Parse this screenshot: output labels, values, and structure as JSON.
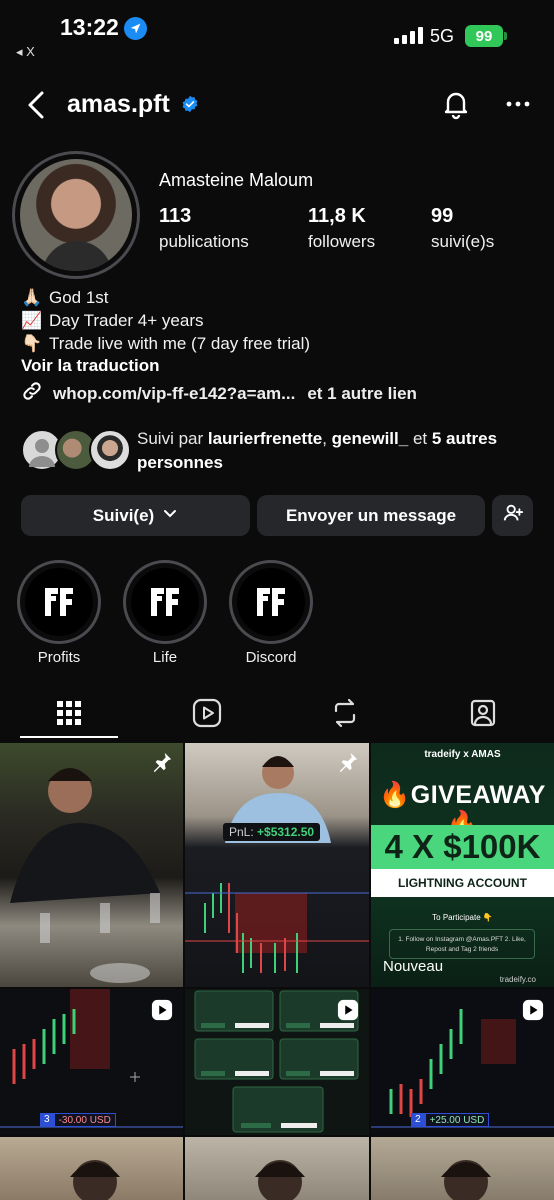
{
  "status_bar": {
    "time": "13:22",
    "back_app": "◂ X",
    "network": "5G",
    "battery": "99"
  },
  "header": {
    "username": "amas.pft"
  },
  "profile": {
    "full_name": "Amasteine Maloum",
    "stats": [
      {
        "number": "113",
        "label": "publications"
      },
      {
        "number": "11,8 K",
        "label": "followers"
      },
      {
        "number": "99",
        "label": "suivi(e)s"
      }
    ],
    "bio": [
      {
        "emoji": "🙏🏻",
        "text": "God 1st"
      },
      {
        "emoji": "📈",
        "text": "Day Trader 4+ years"
      },
      {
        "emoji": "👇🏻",
        "text": "Trade live with me (7 day free trial)"
      }
    ],
    "translate": "Voir la traduction",
    "link": "whop.com/vip-ff-e142?a=am...",
    "more_links": "et 1 autre lien",
    "followed_by": {
      "prefix": "Suivi par",
      "name1": "laurierfrenette",
      "sep": ",",
      "name2": "genewill_",
      "mid": "et",
      "others": "5 autres",
      "suffix": "personnes"
    }
  },
  "buttons": {
    "following": "Suivi(e)",
    "message": "Envoyer un message"
  },
  "highlights": [
    {
      "label": "Profits"
    },
    {
      "label": "Life"
    },
    {
      "label": "Discord"
    }
  ],
  "tabs": [
    "grid-icon",
    "reels-icon",
    "reposts-icon",
    "tagged-icon"
  ],
  "posts": {
    "post2_pnl_label": "PnL:",
    "post2_pnl_value": "+$5312.50",
    "giveaway": {
      "top": "tradeify  x  AMAS",
      "title": "🔥GIVEAWAY🔥",
      "big": "4 X $100K",
      "sub": "LIGHTNING ACCOUNT",
      "participate": "To Participate 👇",
      "steps": "1. Follow on Instagram @Amas.PFT  2. Like, Repost and Tag 2 friends",
      "site": "tradeify.co",
      "new_badge": "Nouveau"
    },
    "post4_badge_num": "3",
    "post4_badge_value": "-30.00 USD",
    "post6_badge_num": "2",
    "post6_badge_value": "+25.00 USD"
  },
  "colors": {
    "background": "#0b0b0c",
    "button": "#26272b",
    "verified": "#1c8cf5",
    "green": "#4ad67c"
  }
}
